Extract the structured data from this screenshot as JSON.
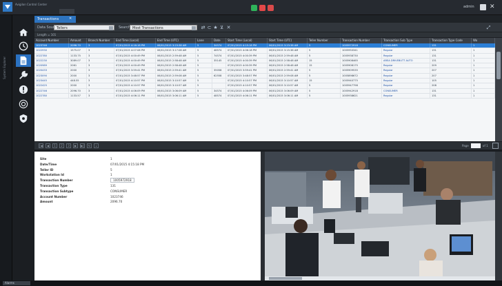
{
  "app": {
    "title": "Avigilon Control Center",
    "user_name": "admin",
    "tray_colors": [
      "#2fb35a",
      "#e34848",
      "#d9d9d9"
    ]
  },
  "sidebar": {
    "label": "System Explorer",
    "nav_icons": [
      "home-icon",
      "clock-icon",
      "document-icon",
      "tools-icon",
      "alert-icon",
      "camera-icon",
      "shield-icon"
    ],
    "active_index": 2
  },
  "tab": {
    "label": "Transactions",
    "close": "✕"
  },
  "filter": {
    "data_source_label": "Data Source",
    "data_source_value": "Tellers",
    "search_label": "Search",
    "search_value": "Most Transactions",
    "record_count": "Length = 101"
  },
  "grid": {
    "columns": [
      "Account Number",
      "Amount",
      "Branch Number",
      "End Time (Local)",
      "End Time (UTC)",
      "Lane",
      "Date",
      "Start Time (Local)",
      "Start Time (UTC)",
      "Teller Number",
      "Transaction Number",
      "Transaction Sub Type",
      "Transaction Type Code",
      "Wo"
    ],
    "rows": [
      [
        "1023746",
        "2096.70",
        "3",
        "07/01/2015 4:16:18 PM",
        "06/01/2015 3:23:38 AM",
        "5",
        "34574",
        "07/01/2015 4:15:18 PM",
        "06/01/2015 3:23:38 AM",
        "5",
        "1005972918",
        "CONSUMER",
        "131",
        "1"
      ],
      [
        "1022930",
        "1575.07",
        "3",
        "07/01/2015 4:07:08 PM",
        "06/01/2015 3:17:08 AM",
        "5",
        "48574",
        "07/01/2015 4:06:18 PM",
        "06/01/2015 3:15:38 AM",
        "5",
        "1005950341",
        "Regular",
        "131",
        "1"
      ],
      [
        "1022780",
        "1133.75",
        "3",
        "07/01/2015 4:00:49 PM",
        "06/01/2015 2:59:48 AM",
        "5",
        "74574",
        "07/01/2015 4:00:39 PM",
        "06/01/2015 2:59:48 AM",
        "5",
        "1005938730",
        "Regular",
        "131",
        "1"
      ],
      [
        "1022230",
        "3089.07",
        "3",
        "07/01/2015 4:00:49 PM",
        "06/01/2015 2:58:48 AM",
        "5",
        "35145",
        "07/01/2015 4:00:39 PM",
        "06/01/2015 2:58:48 AM",
        "15",
        "1005908465",
        "AREA DRIVEBUTT AUTO",
        "131",
        "1"
      ],
      [
        "1020989",
        "2061",
        "3",
        "07/01/2015 4:00:49 PM",
        "06/01/2015 2:58:48 AM",
        "5",
        "",
        "07/01/2015 4:00:39 PM",
        "06/01/2015 2:58:48 AM",
        "15",
        "1005908175",
        "Regular",
        "209",
        "1"
      ],
      [
        "1020433",
        "2000",
        "3",
        "07/01/2015 3:59:41 PM",
        "06/01/2015 2:59:41 AM",
        "5",
        "35058",
        "07/01/2015 3:59:41 PM",
        "06/01/2015 2:59:41 AM",
        "5",
        "1005909535",
        "Regular",
        "207",
        "1"
      ],
      [
        "1023090",
        "2000",
        "3",
        "07/01/2015 3:48:57 PM",
        "06/01/2015 2:59:08 AM",
        "5",
        "62558",
        "07/01/2015 3:48:57 PM",
        "06/01/2015 2:59:08 AM",
        "5",
        "1005898672",
        "Regular",
        "207",
        "1"
      ],
      [
        "1023445",
        "448.55",
        "3",
        "07/01/2015 4:10:57 PM",
        "06/01/2015 3:10:57 AM",
        "5",
        "",
        "07/01/2015 4:10:57 PM",
        "06/01/2015 3:10:57 AM",
        "15",
        "1005940775",
        "Regular",
        "105",
        "1"
      ],
      [
        "1022425",
        "2000",
        "3",
        "07/01/2015 4:10:57 PM",
        "06/01/2015 3:10:57 AM",
        "5",
        "",
        "07/01/2015 4:10:57 PM",
        "06/01/2015 3:10:57 AM",
        "5",
        "1005947798",
        "Regular",
        "208",
        "1"
      ],
      [
        "1022746",
        "2096.70",
        "3",
        "07/01/2015 4:06:09 PM",
        "06/01/2015 3:06:09 AM",
        "5",
        "34574",
        "07/01/2015 4:06:09 PM",
        "06/01/2015 3:06:09 AM",
        "5",
        "1005942918",
        "CONSUMER",
        "131",
        "1"
      ],
      [
        "1022780",
        "1133.57",
        "3",
        "07/01/2015 4:06:11 PM",
        "06/01/2015 3:06:11 AM",
        "5",
        "48574",
        "07/01/2015 4:06:11 PM",
        "06/01/2015 3:06:11 AM",
        "5",
        "1005938621",
        "Regular",
        "131",
        "1"
      ]
    ],
    "selected_index": 0
  },
  "pager": {
    "buttons": [
      "|◀",
      "◀",
      "1",
      "2",
      "3",
      "▶",
      "▶|",
      "↻",
      "⇣"
    ],
    "page_label": "Page",
    "total": "of 1"
  },
  "details": [
    {
      "label": "Site",
      "value": "1"
    },
    {
      "label": "Date/Time",
      "value": "07/01/2015 4:15:18 PM"
    },
    {
      "label": "Teller ID",
      "value": "5"
    },
    {
      "label": "Workstation Id",
      "value": "1"
    },
    {
      "label": "Transaction Number",
      "value": "1005972918"
    },
    {
      "label": "Transaction Type",
      "value": "131"
    },
    {
      "label": "Transaction Subtype",
      "value": "CONSUMER"
    },
    {
      "label": "Account Number",
      "value": "1023746"
    },
    {
      "label": "Amount",
      "value": "2096.70"
    }
  ],
  "statusbar": {
    "tab_label": "Alarms"
  }
}
